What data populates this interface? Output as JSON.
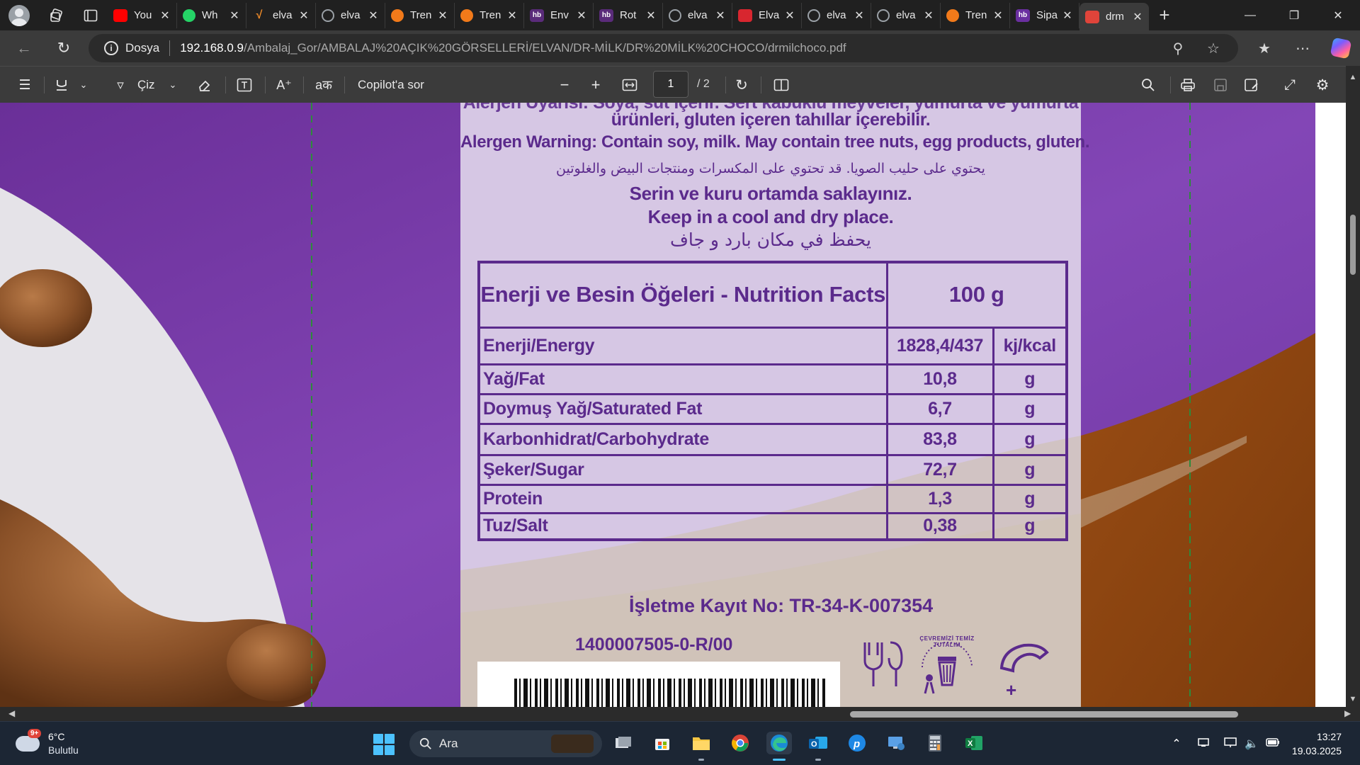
{
  "browser": {
    "tabs": [
      {
        "title": "You",
        "icon": "youtube-icon",
        "color": "#ff0000"
      },
      {
        "title": "Wh",
        "icon": "whatsapp-icon",
        "color": "#25d366"
      },
      {
        "title": "elva",
        "icon": "checkmark-logo-icon",
        "color": "#f28c28"
      },
      {
        "title": "elva",
        "icon": "globe-icon",
        "color": "#9aa0a6"
      },
      {
        "title": "Tren",
        "icon": "trendyol-icon",
        "color": "#f27a1a"
      },
      {
        "title": "Tren",
        "icon": "trendyol-icon",
        "color": "#f27a1a"
      },
      {
        "title": "Env",
        "icon": "hb-icon",
        "color": "#5a2b7a"
      },
      {
        "title": "Rot",
        "icon": "hb-icon",
        "color": "#5a2b7a"
      },
      {
        "title": "elva",
        "icon": "globe-icon",
        "color": "#9aa0a6"
      },
      {
        "title": "Elva",
        "icon": "red-logo-icon",
        "color": "#d8262f"
      },
      {
        "title": "elva",
        "icon": "globe-icon",
        "color": "#9aa0a6"
      },
      {
        "title": "elva",
        "icon": "globe-icon",
        "color": "#9aa0a6"
      },
      {
        "title": "Tren",
        "icon": "trendyol-icon",
        "color": "#f27a1a"
      },
      {
        "title": "Sipa",
        "icon": "hb-icon",
        "color": "#6a2fa0"
      },
      {
        "title": "drm",
        "icon": "pdf-icon",
        "color": "#e0443a",
        "active": true
      }
    ],
    "address": {
      "protocol_label": "Dosya",
      "url_host": "192.168.0.9",
      "url_path": "/Ambalaj_Gor/AMBALAJ%20AÇIK%20GÖRSELLERİ/ELVAN/DR-MİLK/DR%20MİLK%20CHOCO/drmilchoco.pdf"
    }
  },
  "pdf_toolbar": {
    "draw_label": "Çiz",
    "copilot_label": "Copilot'a sor",
    "current_page": "1",
    "total_pages": "/ 2"
  },
  "label": {
    "cut_line": "Alerjen Uyarısı: Soya, süt içerir. Sert kabuklu meyveler, yumurta ve yumurta",
    "tr_allergen_2": "ürünleri, gluten içeren tahıllar içerebilir.",
    "en_allergen": "Alergen Warning: Contain soy, milk. May contain tree nuts, egg products, gluten.",
    "ar_allergen": "يحتوي على حليب الصويا. قد تحتوي على المكسرات ومنتجات البيض والغلوتين",
    "tr_storage": "Serin ve kuru ortamda saklayınız.",
    "en_storage": "Keep in a cool and dry place.",
    "ar_storage": "يحفظ في مكان بارد و جاف",
    "nutrition": {
      "header": "Enerji ve Besin Öğeleri - Nutrition Facts",
      "per": "100 g",
      "rows": [
        {
          "name": "Enerji/Energy",
          "value": "1828,4/437",
          "unit": "kj/kcal"
        },
        {
          "name": "Yağ/Fat",
          "value": "10,8",
          "unit": "g"
        },
        {
          "name": "Doymuş Yağ/Saturated Fat",
          "value": "6,7",
          "unit": "g"
        },
        {
          "name": "Karbonhidrat/Carbohydrate",
          "value": "83,8",
          "unit": "g"
        },
        {
          "name": "Şeker/Sugar",
          "value": "72,7",
          "unit": "g"
        },
        {
          "name": "Protein",
          "value": "1,3",
          "unit": "g"
        },
        {
          "name": "Tuz/Salt",
          "value": "0,38",
          "unit": "g"
        }
      ]
    },
    "registration": "İşletme Kayıt No: TR-34-K-007354",
    "lot": "1400007505-0-R/00",
    "recycle_text": "ÇEVREMİZİ TEMİZ TUTALIM"
  },
  "taskbar": {
    "weather_temp": "6°C",
    "weather_desc": "Bulutlu",
    "weather_badge": "9+",
    "search_label": "Ara",
    "time": "13:27",
    "date": "19.03.2025",
    "apps": [
      "task-view-icon",
      "store-icon",
      "file-explorer-icon",
      "chrome-icon",
      "edge-icon",
      "outlook-icon",
      "app-p-icon",
      "remote-desktop-icon",
      "calculator-icon",
      "excel-icon"
    ]
  }
}
